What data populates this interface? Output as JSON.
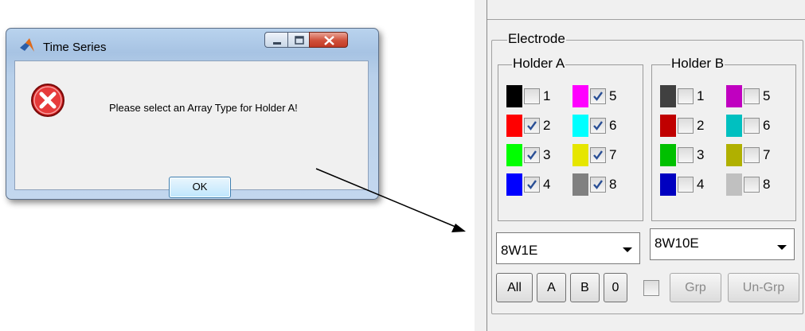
{
  "dialog": {
    "title": "Time Series",
    "message": "Please select an Array Type for Holder A!",
    "ok_label": "OK",
    "icons": {
      "app": "matlab-icon",
      "error": "error-icon"
    }
  },
  "panel": {
    "electrode_title": "Electrode",
    "holder_a": {
      "title": "Holder A",
      "channels": [
        {
          "label": "1",
          "color": "#000000",
          "checked": false
        },
        {
          "label": "2",
          "color": "#ff0000",
          "checked": true
        },
        {
          "label": "3",
          "color": "#00ff00",
          "checked": true
        },
        {
          "label": "4",
          "color": "#0000ff",
          "checked": true
        },
        {
          "label": "5",
          "color": "#ff00ff",
          "checked": true
        },
        {
          "label": "6",
          "color": "#00ffff",
          "checked": true
        },
        {
          "label": "7",
          "color": "#e6e600",
          "checked": true
        },
        {
          "label": "8",
          "color": "#808080",
          "checked": true
        }
      ],
      "array_type": "8W1E"
    },
    "holder_b": {
      "title": "Holder B",
      "channels": [
        {
          "label": "1",
          "color": "#404040",
          "checked": false
        },
        {
          "label": "2",
          "color": "#c00000",
          "checked": false
        },
        {
          "label": "3",
          "color": "#00c000",
          "checked": false
        },
        {
          "label": "4",
          "color": "#0000c0",
          "checked": false
        },
        {
          "label": "5",
          "color": "#c000c0",
          "checked": false
        },
        {
          "label": "6",
          "color": "#00c0c0",
          "checked": false
        },
        {
          "label": "7",
          "color": "#b0b000",
          "checked": false
        },
        {
          "label": "8",
          "color": "#c0c0c0",
          "checked": false
        }
      ],
      "array_type": "8W10E"
    },
    "buttons": {
      "all": "All",
      "a": "A",
      "b": "B",
      "zero": "0",
      "grp": "Grp",
      "ungrp": "Un-Grp"
    }
  }
}
